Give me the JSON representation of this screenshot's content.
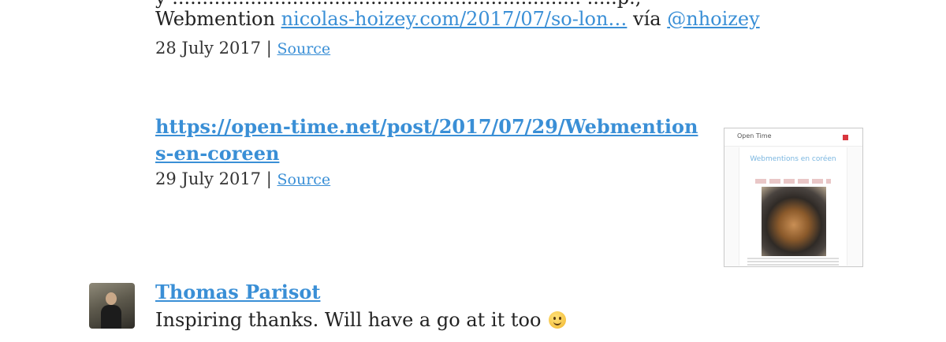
{
  "entries": [
    {
      "prefix": "Webmention",
      "link_text": "nicolas-hoizey.com/2017/07/so-lon…",
      "via_label": "vía",
      "via_handle": "@nhoizey",
      "date": "28 July 2017",
      "separator": "|",
      "source_label": "Source"
    },
    {
      "url": "https://open-time.net/post/2017/07/29/Webmentions-en-coreen",
      "date": "29 July 2017",
      "separator": "|",
      "source_label": "Source",
      "thumbnail": {
        "site_title": "Open Time",
        "post_title": "Webmentions en coréen"
      }
    }
  ],
  "comment": {
    "author": "Thomas Parisot",
    "text": "Inspiring thanks. Will have a go at it too",
    "emoji": "🙂"
  }
}
